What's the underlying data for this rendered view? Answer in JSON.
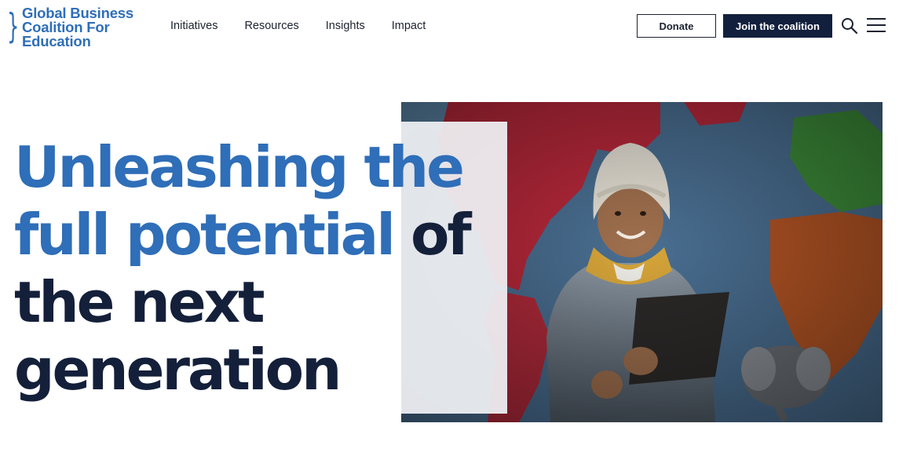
{
  "header": {
    "logo": {
      "line1": "Global Business",
      "line2": "Coalition For",
      "line3": "Education",
      "brace": "}"
    },
    "nav": [
      {
        "label": "Initiatives"
      },
      {
        "label": "Resources"
      },
      {
        "label": "Insights"
      },
      {
        "label": "Impact"
      }
    ],
    "donate_label": "Donate",
    "join_label": "Join the coalition",
    "search_icon": "search-icon",
    "menu_icon": "hamburger-menu-icon"
  },
  "hero": {
    "headline": {
      "line1": "Unleashing the",
      "line2_blue": "full potential",
      "line2_dark": " of",
      "line3": "the next",
      "line4": "generation"
    },
    "image_subject": "child holding a tablet in front of a world map wall"
  },
  "colors": {
    "brand_blue": "#2f6eb8",
    "navy": "#13203d",
    "text_dark": "#1b2230"
  }
}
